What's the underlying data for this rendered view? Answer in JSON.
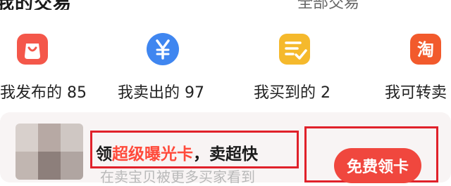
{
  "header": {
    "title": "我的交易",
    "right_text": "全部交易"
  },
  "shortcuts": [
    {
      "label": "我发布的 85",
      "icon": "bag-icon",
      "color": "#f4574a"
    },
    {
      "label": "我卖出的 97",
      "icon": "yen-icon",
      "color": "#3f86f0"
    },
    {
      "label": "我买到的 2",
      "icon": "checklist-icon",
      "color": "#f5b92c"
    },
    {
      "label": "我可转卖",
      "icon": "taobao-icon",
      "color": "#f25a2c"
    }
  ],
  "promo": {
    "headline_prefix": "领",
    "headline_highlight": "超级曝光卡",
    "headline_suffix": "，卖超快",
    "subtext": "在卖宝贝被更多买家看到",
    "button_label": "免费领卡",
    "accent_color": "#f0473e"
  }
}
